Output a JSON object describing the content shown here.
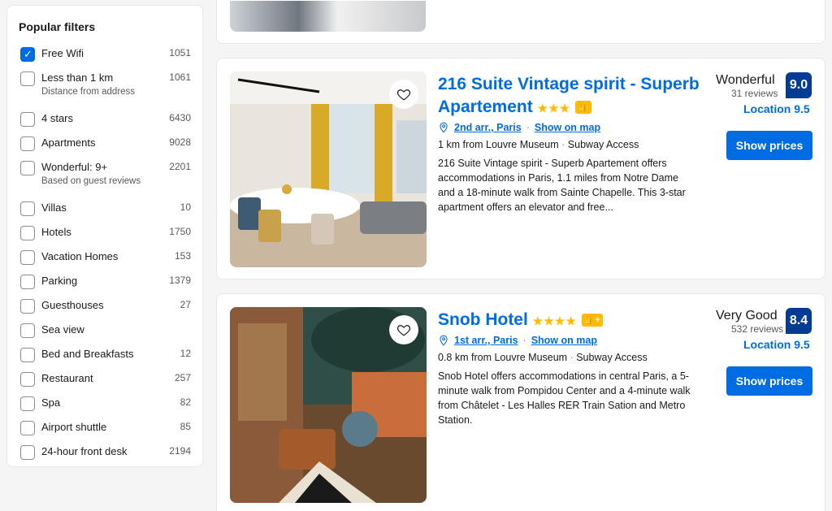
{
  "filters": {
    "title": "Popular filters",
    "items": [
      {
        "label": "Free Wifi",
        "count": "1051",
        "checked": true
      },
      {
        "label": "Less than 1 km",
        "sub": "Distance from address",
        "count": "1061",
        "checked": false
      },
      {
        "label": "4 stars",
        "count": "6430",
        "checked": false
      },
      {
        "label": "Apartments",
        "count": "9028",
        "checked": false
      },
      {
        "label": "Wonderful: 9+",
        "sub": "Based on guest reviews",
        "count": "2201",
        "checked": false
      },
      {
        "label": "Villas",
        "count": "10",
        "checked": false
      },
      {
        "label": "Hotels",
        "count": "1750",
        "checked": false
      },
      {
        "label": "Vacation Homes",
        "count": "153",
        "checked": false
      },
      {
        "label": "Parking",
        "count": "1379",
        "checked": false
      },
      {
        "label": "Guesthouses",
        "count": "27",
        "checked": false
      },
      {
        "label": "Sea view",
        "count": "",
        "checked": false
      },
      {
        "label": "Bed and Breakfasts",
        "count": "12",
        "checked": false
      },
      {
        "label": "Restaurant",
        "count": "257",
        "checked": false
      },
      {
        "label": "Spa",
        "count": "82",
        "checked": false
      },
      {
        "label": "Airport shuttle",
        "count": "85",
        "checked": false
      },
      {
        "label": "24-hour front desk",
        "count": "2194",
        "checked": false
      }
    ]
  },
  "listings": [
    {
      "title": "216 Suite Vintage spirit - Superb Apartement",
      "stars": "★★★",
      "badge": "👍",
      "area": "2nd arr., Paris",
      "show_map": "Show on map",
      "distance": "1 km from Louvre Museum",
      "transit": "Subway Access",
      "description": "216 Suite Vintage spirit - Superb Apartement offers accommodations in Paris, 1.1 miles from Notre Dame and a 18-minute walk from Sainte Chapelle. This 3-star apartment offers an elevator and free...",
      "rating_word": "Wonderful",
      "reviews": "31 reviews",
      "score": "9.0",
      "location_score": "Location 9.5",
      "cta": "Show prices"
    },
    {
      "title": "Snob Hotel",
      "stars": "★★★★",
      "badge": "👍+",
      "area": "1st arr., Paris",
      "show_map": "Show on map",
      "distance": "0.8 km from Louvre Museum",
      "transit": "Subway Access",
      "description": "Snob Hotel offers accommodations in central Paris, a 5-minute walk from Pompidou Center and a 4-minute walk from Châtelet - Les Halles RER Train Sation and Metro Station.",
      "rating_word": "Very Good",
      "reviews": "532 reviews",
      "score": "8.4",
      "location_score": "Location 9.5",
      "cta": "Show prices"
    }
  ],
  "colors": {
    "accent": "#006ce4",
    "score_bg": "#003b95",
    "star": "#febb02"
  }
}
